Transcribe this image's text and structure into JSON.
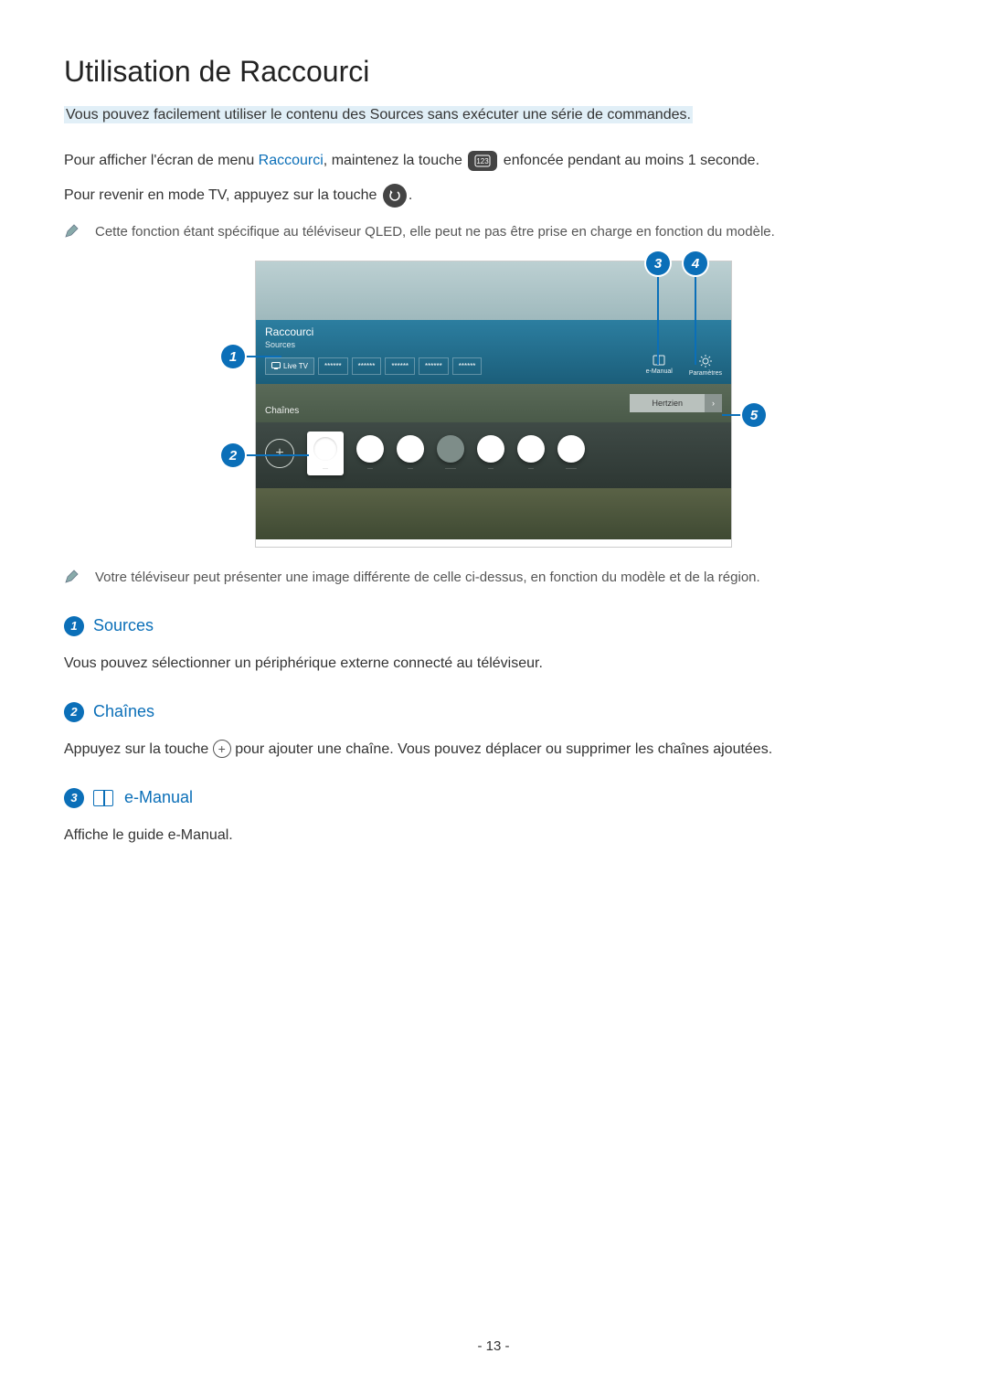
{
  "title": "Utilisation de Raccourci",
  "intro": "Vous pouvez facilement utiliser le contenu des Sources sans exécuter une série de commandes.",
  "para1_a": "Pour afficher l'écran de menu ",
  "para1_link": "Raccourci",
  "para1_b": ", maintenez la touche ",
  "para1_c": " enfoncée pendant au moins 1 seconde.",
  "para2_a": "Pour revenir en mode TV, appuyez sur la touche ",
  "para2_b": ".",
  "note1": "Cette fonction étant spécifique au téléviseur QLED, elle peut ne pas être prise en charge en fonction du modèle.",
  "note2": "Votre téléviseur peut présenter une image différente de celle ci-dessus, en fonction du modèle et de la région.",
  "tv": {
    "panel_title": "Raccourci",
    "panel_sub": "Sources",
    "live_tv": "Live TV",
    "placeholder": "******",
    "right1": "e-Manual",
    "right2": "Paramètres",
    "hertzien": "Hertzien",
    "chaines": "Chaînes"
  },
  "callouts": {
    "c1": "1",
    "c2": "2",
    "c3": "3",
    "c4": "4",
    "c5": "5"
  },
  "sections": {
    "s1": {
      "num": "1",
      "title": "Sources",
      "body": "Vous pouvez sélectionner un périphérique externe connecté au téléviseur."
    },
    "s2": {
      "num": "2",
      "title": "Chaînes",
      "body_a": "Appuyez sur la touche ",
      "body_b": " pour ajouter une chaîne. Vous pouvez déplacer ou supprimer les chaînes ajoutées."
    },
    "s3": {
      "num": "3",
      "title": "e-Manual",
      "body": "Affiche le guide e-Manual."
    }
  },
  "page_number": "- 13 -"
}
